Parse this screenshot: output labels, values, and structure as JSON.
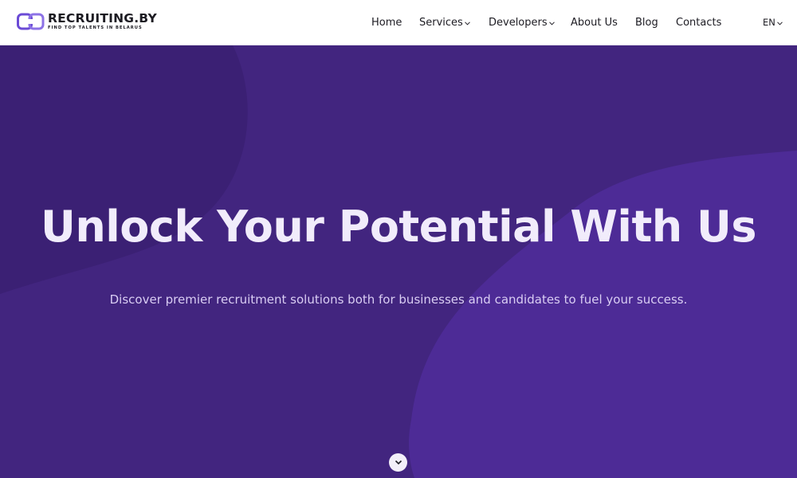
{
  "header": {
    "logo": {
      "title": "RECRUITING.BY",
      "tagline": "FIND TOP TALENTS IN BELARUS",
      "icon": "linked-rings-logo-icon",
      "accent_color": "#6b4bd6"
    },
    "nav": {
      "home": "Home",
      "services": "Services",
      "developers": "Developers",
      "about": "About Us",
      "blog": "Blog",
      "contacts": "Contacts",
      "language": "EN",
      "dropdown_icon": "chevron-down-icon"
    }
  },
  "hero": {
    "title": "Unlock Your Potential With Us",
    "subtitle": "Discover premier recruitment solutions both for businesses and candidates to fuel your success.",
    "scroll_icon": "chevron-down-icon",
    "colors": {
      "background": "#42257f",
      "shape_dark": "#3b2074",
      "shape_light": "#4d2b96",
      "title": "#f1ecfb"
    }
  }
}
